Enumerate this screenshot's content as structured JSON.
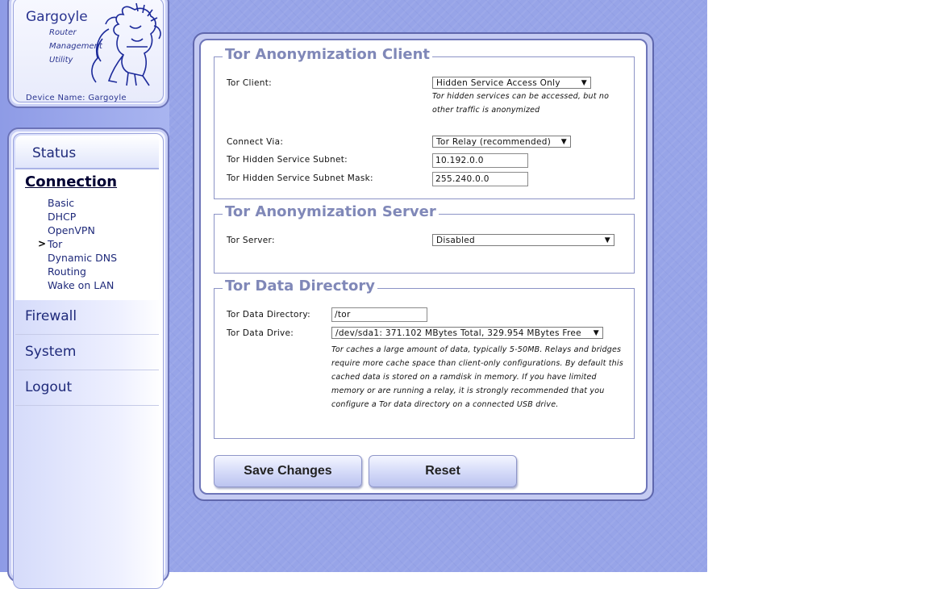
{
  "brand": {
    "title": "Gargoyle",
    "subtitle_lines": [
      "Router",
      "Management",
      "Utility"
    ],
    "device_name": "Device Name: Gargoyle",
    "logo_icon": "gargoyle-logo"
  },
  "nav": {
    "status": "Status",
    "connection": "Connection",
    "connection_items": [
      "Basic",
      "DHCP",
      "OpenVPN",
      "Tor",
      "Dynamic DNS",
      "Routing",
      "Wake on LAN"
    ],
    "active_item_marker": ">",
    "firewall": "Firewall",
    "system": "System",
    "logout": "Logout"
  },
  "client": {
    "title": "Tor Anonymization Client",
    "tor_client_label": "Tor Client:",
    "tor_client_value": "Hidden Service Access Only",
    "tor_client_note": "Tor hidden services can be accessed, but no other traffic is anonymized",
    "connect_via_label": "Connect Via:",
    "connect_via_value": "Tor Relay (recommended)",
    "subnet_label": "Tor Hidden Service Subnet:",
    "subnet_value": "10.192.0.0",
    "mask_label": "Tor Hidden Service Subnet Mask:",
    "mask_value": "255.240.0.0"
  },
  "server": {
    "title": "Tor Anonymization Server",
    "tor_server_label": "Tor Server:",
    "tor_server_value": "Disabled"
  },
  "datadir": {
    "title": "Tor Data Directory",
    "dir_label": "Tor Data Directory:",
    "dir_value": "/tor",
    "drive_label": "Tor Data Drive:",
    "drive_value": "/dev/sda1: 371.102 MBytes Total, 329.954 MBytes Free",
    "note": "Tor caches a large amount of data, typically 5-50MB. Relays and bridges require more cache space than client-only configurations. By default this cached data is stored on a ramdisk in memory. If you have limited memory or are running a relay, it is strongly recommended that you configure a Tor data directory on a connected USB drive."
  },
  "buttons": {
    "save": "Save Changes",
    "reset": "Reset"
  },
  "colors": {
    "background": "#97a4e8",
    "section_title": "#8088b8",
    "nav_text": "#1f2a7a"
  }
}
